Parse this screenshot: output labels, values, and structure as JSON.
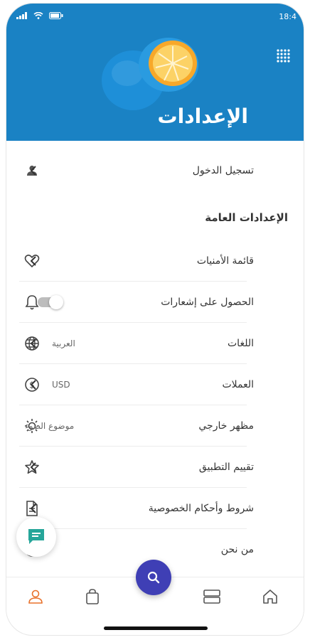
{
  "status": {
    "time": "18:4"
  },
  "header": {
    "title": "الإعدادات"
  },
  "login": {
    "label": "تسجيل الدخول"
  },
  "section": {
    "title": "الإعدادات العامة"
  },
  "items": [
    {
      "label": "قائمة الأمنيات",
      "icon": "heart-icon"
    },
    {
      "label": "الحصول على إشعارات",
      "icon": "bell-icon"
    },
    {
      "label": "اللغات",
      "value": "العربية",
      "icon": "globe-icon"
    },
    {
      "label": "العملات",
      "value": "USD",
      "icon": "dollar-circle-icon"
    },
    {
      "label": "مظهر خارجي",
      "value": "موضوع الضوء",
      "icon": "sun-icon"
    },
    {
      "label": "تقييم التطبيق",
      "icon": "star-icon"
    },
    {
      "label": "شروط وأحكام الخصوصية",
      "icon": "document-icon"
    },
    {
      "label": "من نحن",
      "icon": "info-icon"
    }
  ],
  "notifications_enabled": false,
  "colors": {
    "hero": "#1a82c4",
    "accent": "#3f3fb5",
    "active_tab": "#e8702a"
  },
  "tabs": [
    "home-icon",
    "list-icon",
    "search-icon",
    "bag-icon",
    "user-icon"
  ]
}
